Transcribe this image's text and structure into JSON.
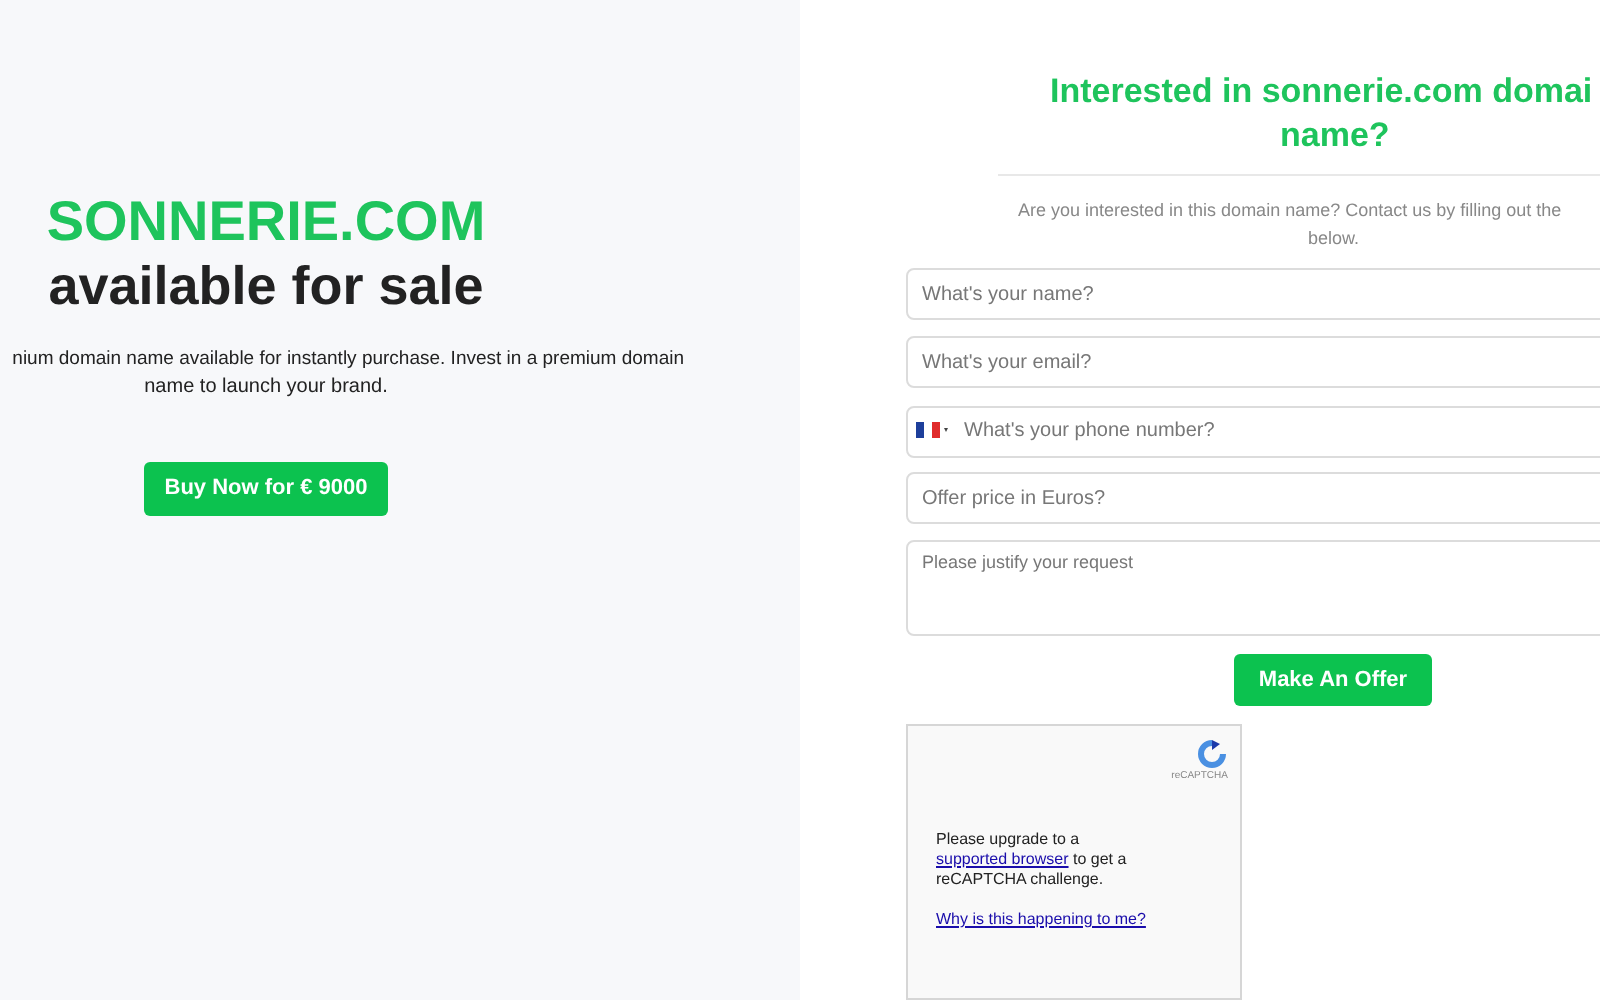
{
  "sale": {
    "domain": "SONNERIE.COM",
    "tagline": "available for sale",
    "description_lines": [
      "nium domain name available for instantly purchase. Invest in a premium domain",
      "name to launch your brand."
    ],
    "buy_button": "Buy Now for € 9000"
  },
  "offer_form": {
    "heading_lines": [
      "Interested in **sonnerie.com** domai",
      "name?"
    ],
    "intro_lines": [
      "Are you interested in this domain name? Contact us by filling out the",
      "below."
    ],
    "fields": [
      {
        "kind": "text",
        "placeholder": "What's your name?"
      },
      {
        "kind": "text",
        "placeholder": "What's your email?"
      },
      {
        "kind": "phone",
        "placeholder": "What's your phone number?"
      },
      {
        "kind": "text",
        "placeholder": "Offer price in Euros?"
      },
      {
        "kind": "textarea",
        "placeholder": "Please justify your request"
      }
    ],
    "submit_button": "Make An Offer",
    "captcha": {
      "logo_label": "reCAPTCHA",
      "message": "Please upgrade to a",
      "link": "supported browser",
      "message_end": "to get a reCAPTCHA challenge.",
      "help_link": "Why is this happening to me?"
    }
  }
}
